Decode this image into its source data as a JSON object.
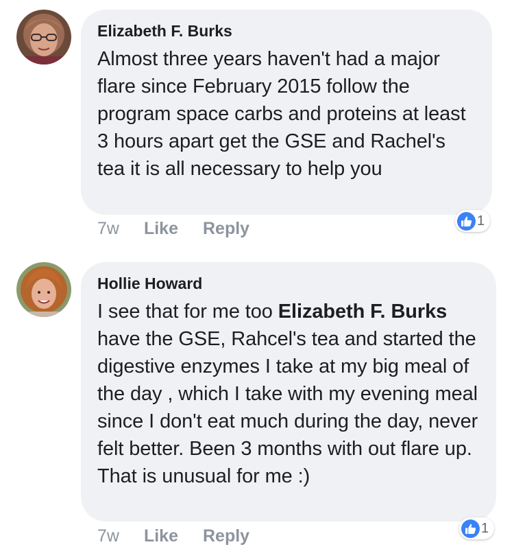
{
  "comments": [
    {
      "author": "Elizabeth F. Burks",
      "text": "Almost three years haven't had a major flare since February 2015 follow the program space carbs and proteins at least 3 hours apart get the GSE and Rachel's tea it is all necessary to help you",
      "time": "7w",
      "like_label": "Like",
      "reply_label": "Reply",
      "reaction_count": "1",
      "reaction_icon": "thumbs-up-icon"
    },
    {
      "author": "Hollie Howard",
      "mention": "Elizabeth F. Burks",
      "text_before_mention": "I see that for me too ",
      "text_after_mention": " have the GSE, Rahcel's tea and started the digestive enzymes I take at my big meal of the day , which I take with my evening meal since I don't eat much during the day, never felt better. Been 3 months with out flare up. That is unusual for me :)",
      "time": "7w",
      "like_label": "Like",
      "reply_label": "Reply",
      "reaction_count": "1",
      "reaction_icon": "thumbs-up-icon"
    }
  ],
  "colors": {
    "bubble": "#f0f1f4",
    "meta_text": "#8d949e",
    "like_blue": "#3b82f6"
  }
}
